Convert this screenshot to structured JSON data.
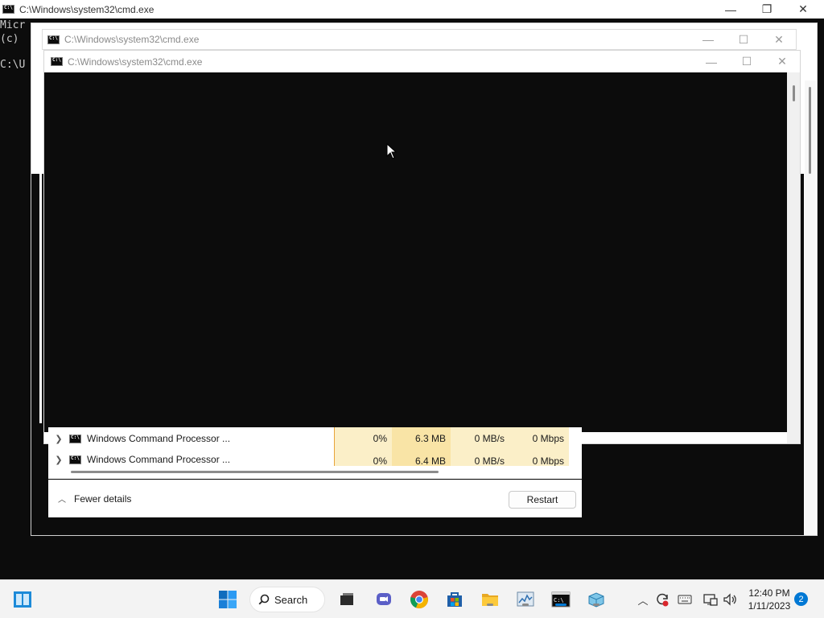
{
  "windows": {
    "back": {
      "title": "C:\\Windows\\system32\\cmd.exe",
      "console_lines": [
        "Micr",
        "(c) ",
        "",
        "C:\\U"
      ]
    },
    "middle": {
      "title": "C:\\Windows\\system32\\cmd.exe"
    },
    "front": {
      "title": "C:\\Windows\\system32\\cmd.exe"
    }
  },
  "caption_buttons": {
    "minimize": "—",
    "maximize": "☐",
    "restore": "❐",
    "close": "✕"
  },
  "task_manager": {
    "rows": [
      {
        "name": "Windows Command Processor ...",
        "cpu": "0%",
        "memory": "6.3 MB",
        "disk": "0 MB/s",
        "network": "0 Mbps"
      },
      {
        "name": "Windows Command Processor ...",
        "cpu": "0%",
        "memory": "6.4 MB",
        "disk": "0 MB/s",
        "network": "0 Mbps"
      }
    ],
    "fewer_details": "Fewer details",
    "restart": "Restart"
  },
  "taskbar": {
    "search_label": "Search",
    "clock_time": "12:40 PM",
    "clock_date": "1/11/2023",
    "notification_count": "2",
    "icons": [
      "start-icon",
      "search-icon",
      "task-view-icon",
      "teams-chat-icon",
      "chrome-icon",
      "store-icon",
      "file-explorer-icon",
      "task-manager-icon",
      "terminal-icon",
      "virtualbox-icon"
    ]
  },
  "colors": {
    "accent": "#0078d4",
    "console_bg": "#0c0c0c",
    "tm_highlight": "#fbefc8",
    "taskbar_bg": "#f3f3f3"
  }
}
